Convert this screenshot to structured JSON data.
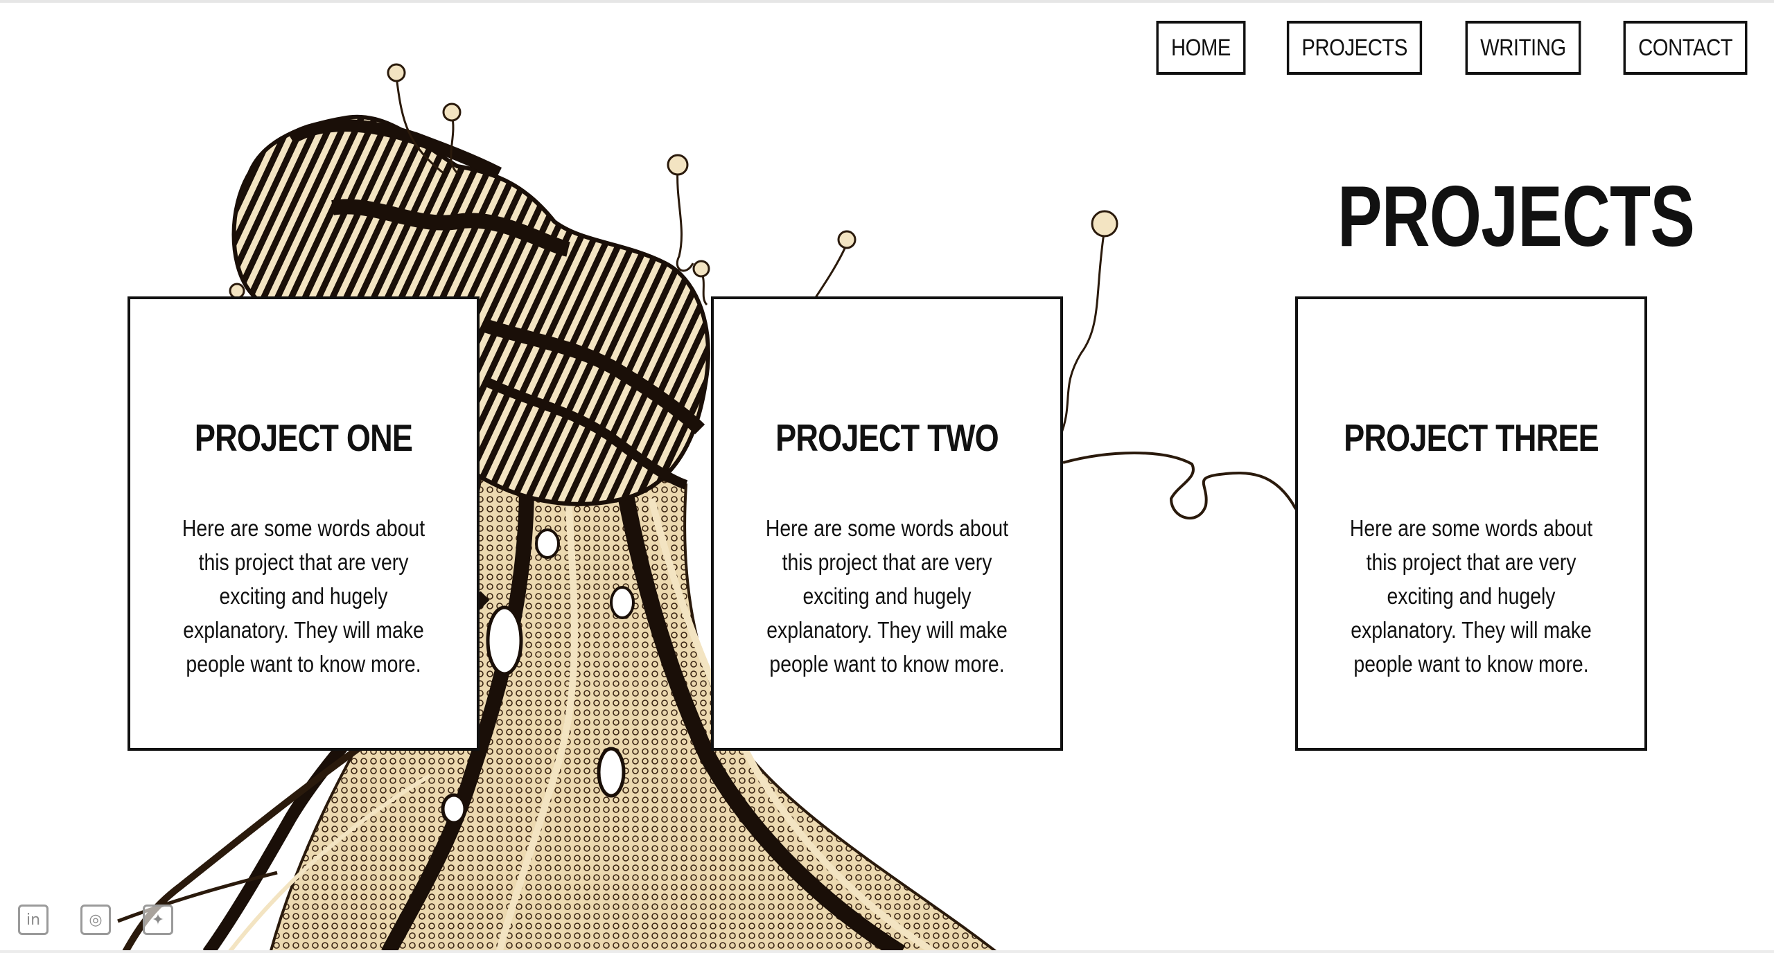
{
  "nav": {
    "items": [
      {
        "label": "HOME"
      },
      {
        "label": "PROJECTS"
      },
      {
        "label": "WRITING"
      },
      {
        "label": "CONTACT"
      }
    ]
  },
  "page_title": "PROJECTS",
  "cards": [
    {
      "title": "PROJECT ONE",
      "body": "Here are some words about this project that are very exciting and hugely explanatory. They will make people want to know more."
    },
    {
      "title": "PROJECT TWO",
      "body": "Here are some words about this project that are very exciting and hugely explanatory. They will make people want to know more."
    },
    {
      "title": "PROJECT THREE",
      "body": "Here are some words about this project that are very exciting and hugely explanatory. They will make people want to know more."
    }
  ],
  "social": {
    "items": [
      {
        "icon": "linkedin-icon",
        "glyph": "in"
      },
      {
        "icon": "instagram-icon",
        "glyph": "◎"
      },
      {
        "icon": "twitter-icon",
        "glyph": "✦"
      }
    ]
  },
  "colors": {
    "ink": "#111111",
    "sepia": "#3a2412",
    "cream": "#f3e4c2"
  }
}
